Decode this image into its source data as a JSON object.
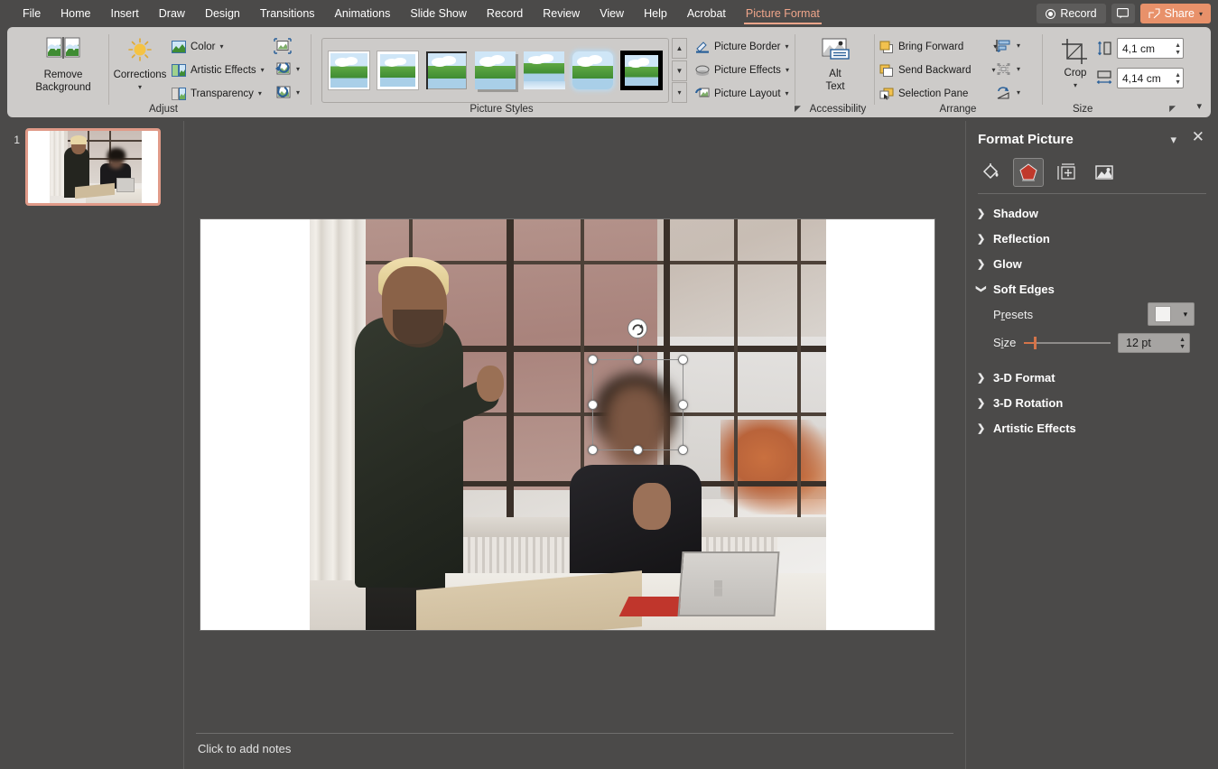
{
  "app": {
    "menu_tabs": [
      "File",
      "Home",
      "Insert",
      "Draw",
      "Design",
      "Transitions",
      "Animations",
      "Slide Show",
      "Record",
      "Review",
      "View",
      "Help",
      "Acrobat"
    ],
    "contextual_tab": "Picture Format",
    "record_button": "Record",
    "share_button": "Share",
    "comment_icon": "comment-icon"
  },
  "ribbon": {
    "groups": [
      {
        "name": "Adjust",
        "label": "Adjust"
      },
      {
        "name": "Picture Styles",
        "label": "Picture Styles"
      },
      {
        "name": "Accessibility",
        "label": "Accessibility"
      },
      {
        "name": "Arrange",
        "label": "Arrange"
      },
      {
        "name": "Size",
        "label": "Size"
      }
    ],
    "adjust": {
      "remove_background": "Remove\nBackground",
      "remove_background_line1": "Remove",
      "remove_background_line2": "Background",
      "corrections": "Corrections",
      "color": "Color",
      "artistic_effects": "Artistic Effects",
      "transparency": "Transparency",
      "compress_pictures_icon": "compress-pictures-icon",
      "change_picture_icon": "change-picture-icon",
      "reset_picture_icon": "reset-picture-icon"
    },
    "picture_styles": {
      "thumbnails": 7,
      "selected_index": 6,
      "scroll_up": "▲",
      "scroll_down": "▼",
      "more": "▼"
    },
    "effects": {
      "picture_border": "Picture Border",
      "picture_effects": "Picture Effects",
      "picture_layout": "Picture Layout"
    },
    "accessibility": {
      "alt_text_line1": "Alt",
      "alt_text_line2": "Text"
    },
    "arrange": {
      "bring_forward": "Bring Forward",
      "send_backward": "Send Backward",
      "selection_pane": "Selection Pane",
      "align_icon": "align-objects-icon",
      "group_icon": "group-objects-icon",
      "rotate_icon": "rotate-objects-icon"
    },
    "size": {
      "crop": "Crop",
      "height_value": "4,1 cm",
      "width_value": "4,14 cm",
      "height_icon": "shape-height-icon",
      "width_icon": "shape-width-icon"
    }
  },
  "slides_panel": {
    "slide_number": "1"
  },
  "notes": {
    "placeholder": "Click to add notes"
  },
  "format_panel": {
    "title": "Format Picture",
    "collapse_icon": "chevron-down-icon",
    "close_icon": "close-icon",
    "tabs": [
      {
        "name": "fill-and-line",
        "icon": "paint-bucket-icon",
        "active": false
      },
      {
        "name": "effects",
        "icon": "pentagon-effects-icon",
        "active": true
      },
      {
        "name": "size-and-properties",
        "icon": "layout-measure-icon",
        "active": false
      },
      {
        "name": "picture",
        "icon": "picture-icon",
        "active": false
      }
    ],
    "sections": [
      {
        "label": "Shadow",
        "expanded": false
      },
      {
        "label": "Reflection",
        "expanded": false
      },
      {
        "label": "Glow",
        "expanded": false
      },
      {
        "label": "Soft Edges",
        "expanded": true
      },
      {
        "label": "3-D Format",
        "expanded": false
      },
      {
        "label": "3-D Rotation",
        "expanded": false
      },
      {
        "label": "Artistic Effects",
        "expanded": false
      }
    ],
    "soft_edges": {
      "presets_label_pre": "P",
      "presets_label_key": "r",
      "presets_label_post": "esets",
      "size_label_pre": "S",
      "size_label_key": "i",
      "size_label_post": "ze",
      "size_value": "12 pt",
      "slider_percent": 12
    }
  },
  "colors": {
    "accent": "#e8916a",
    "contextual_tab": "#efa58a",
    "slider": "#d4744a",
    "ribbon_bg": "#cdcbc9",
    "chrome_bg": "#4b4a49",
    "slide_selection_border": "#e09a88"
  }
}
